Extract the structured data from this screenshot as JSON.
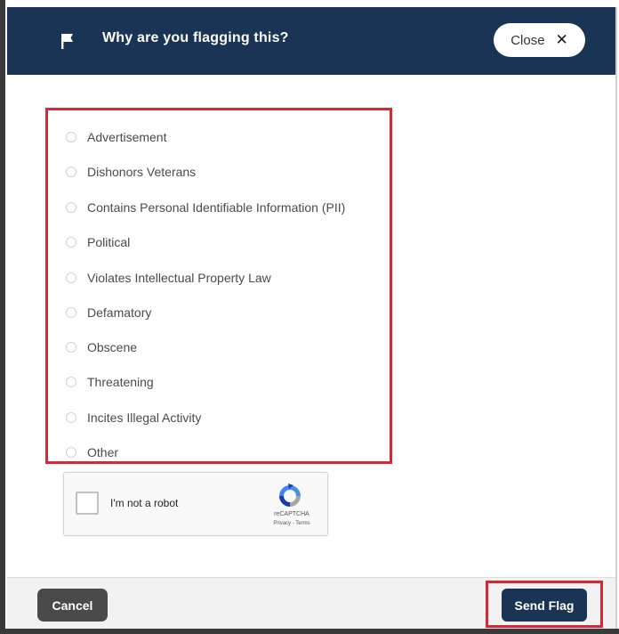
{
  "header": {
    "title": "Why are you flagging this?",
    "close_label": "Close",
    "close_glyph": "✕",
    "flag_icon": "flag-icon",
    "background_color": "#1a3456"
  },
  "options": [
    {
      "label": "Advertisement",
      "selected": false
    },
    {
      "label": "Dishonors Veterans",
      "selected": false
    },
    {
      "label": "Contains Personal Identifiable Information (PII)",
      "selected": false
    },
    {
      "label": "Political",
      "selected": false
    },
    {
      "label": "Violates Intellectual Property Law",
      "selected": false
    },
    {
      "label": "Defamatory",
      "selected": false
    },
    {
      "label": "Obscene",
      "selected": false
    },
    {
      "label": "Threatening",
      "selected": false
    },
    {
      "label": "Incites Illegal Activity",
      "selected": false
    },
    {
      "label": "Other",
      "selected": false
    }
  ],
  "captcha": {
    "label": "I'm not a robot",
    "brand": "reCAPTCHA",
    "links": "Privacy - Terms",
    "checked": false
  },
  "footer": {
    "cancel_label": "Cancel",
    "send_label": "Send Flag"
  },
  "colors": {
    "highlight": "#d42a35",
    "primary": "#1a3456",
    "cancel": "#4a4a4a"
  }
}
